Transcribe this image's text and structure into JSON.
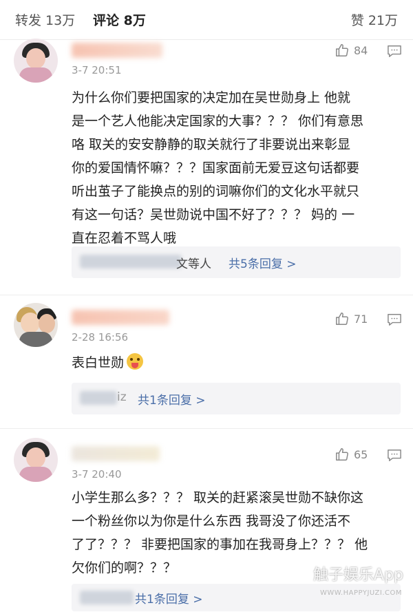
{
  "tabs": [
    {
      "label": "转发 13万"
    },
    {
      "label": "评论 8万"
    },
    {
      "label": "赞 21万"
    }
  ],
  "comments": [
    {
      "time": "3-7 20:51",
      "likes": "84",
      "lines": [
        "为什么你们要把国家的决定加在吴世勋身上 他就",
        "是一个艺人他能决定国家的大事？？？ 你们有意思",
        "咯 取关的安安静静的取关就行了非要说出来彰显",
        "你的爱国情怀嘛？？？国家面前无爱豆这句话都要",
        "听出茧子了能换点的别的词嘛你们的文化水平就只",
        "有这一句话？吴世勋说中国不好了？？？ 妈的 一",
        "直在忍着不骂人哦"
      ],
      "reply_suffix": "文等人",
      "reply_more": "共5条回复 >"
    },
    {
      "time": "2-28 16:56",
      "likes": "71",
      "lines": [
        "表白世勋"
      ],
      "reply_suffix": "iz",
      "reply_more": "共1条回复 >"
    },
    {
      "time": "3-7 20:40",
      "likes": "65",
      "lines": [
        "小学生那么多？？？ 取关的赶紧滚吴世勋不缺你这",
        "一个粉丝你以为你是什么东西 我哥没了你还活不",
        "了了？？？ 非要把国家的事加在我哥身上？？？ 他",
        "欠你们的啊？？？"
      ],
      "reply_suffix": "",
      "reply_more": "共1条回复 >"
    }
  ],
  "watermark": {
    "text": "触子娱乐App",
    "sub": "WWW.HAPPYJUZI.COM"
  },
  "colors": {
    "link": "#4a6ea8",
    "muted": "#999999",
    "reply_bg": "#f4f4f6"
  }
}
